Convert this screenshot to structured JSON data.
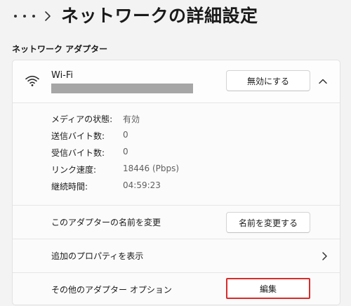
{
  "header": {
    "more_icon": "more-horizontal-icon",
    "separator_icon": "chevron-right-icon",
    "title": "ネットワークの詳細設定"
  },
  "section": {
    "label": "ネットワーク アダプター"
  },
  "adapter": {
    "icon": "wifi-icon",
    "name": "Wi-Fi",
    "disable_button": "無効にする",
    "expand_icon": "chevron-up-icon"
  },
  "details": [
    {
      "key": "メディアの状態:",
      "value": "有効"
    },
    {
      "key": "送信バイト数:",
      "value": "0"
    },
    {
      "key": "受信バイト数:",
      "value": "0"
    },
    {
      "key": "リンク速度:",
      "value": "18446 (Pbps)"
    },
    {
      "key": "継続時間:",
      "value": "04:59:23"
    }
  ],
  "actions": {
    "rename": {
      "label": "このアダプターの名前を変更",
      "button": "名前を変更する"
    },
    "properties": {
      "label": "追加のプロパティを表示",
      "icon": "chevron-right-icon"
    },
    "options": {
      "label": "その他のアダプター オプション",
      "button": "編集"
    }
  },
  "colors": {
    "highlight_border": "#d92b2b",
    "redacted": "#a6a6a6"
  }
}
